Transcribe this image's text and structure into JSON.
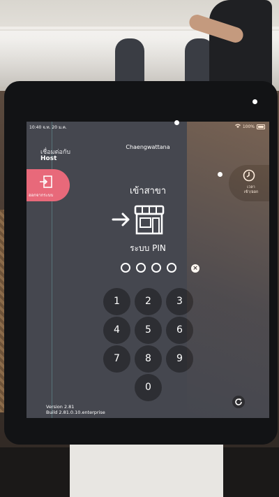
{
  "status_bar": {
    "time": "10:40",
    "date": "จ.ท. 20 ม.ค.",
    "battery": "100%"
  },
  "header": {
    "connected_label": "เชื่อมต่อกับ",
    "host": "Host",
    "branch": "Chaengwattana"
  },
  "logout": {
    "label": "ออกจากระบบ",
    "icon": "logout-icon"
  },
  "clock": {
    "label_line1": "เวลา",
    "label_line2": "เข้า/ออก",
    "icon": "clock-icon"
  },
  "main": {
    "mode_title": "เข้าสาขา",
    "pin_label": "ระบบ PIN",
    "pin_length": 4,
    "clear_glyph": "×"
  },
  "keypad": {
    "keys": [
      "1",
      "2",
      "3",
      "4",
      "5",
      "6",
      "7",
      "8",
      "9",
      "0"
    ]
  },
  "footer": {
    "version": "Version 2.81",
    "build": "Build 2.81.0.10.enterprise"
  },
  "colors": {
    "screen_bg": "#45474f",
    "accent_logout": "#e8697a",
    "key_bg": "#2d2e33"
  }
}
